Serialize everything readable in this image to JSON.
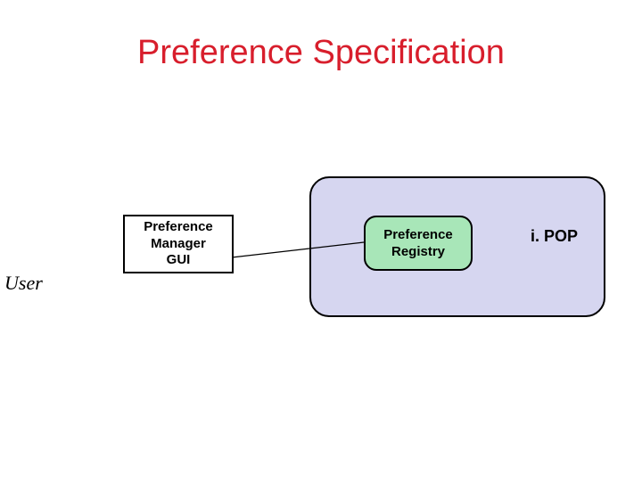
{
  "title": "Preference Specification",
  "user_label": "User",
  "nodes": {
    "pref_manager_gui": {
      "line1": "Preference",
      "line2": "Manager",
      "line3": "GUI"
    },
    "pref_registry": {
      "line1": "Preference",
      "line2": "Registry"
    },
    "ipop": "i. POP"
  },
  "colors": {
    "title": "#d81e2c",
    "container_fill": "#d6d6f0",
    "registry_fill": "#a8e6b8",
    "stroke": "#000000"
  }
}
